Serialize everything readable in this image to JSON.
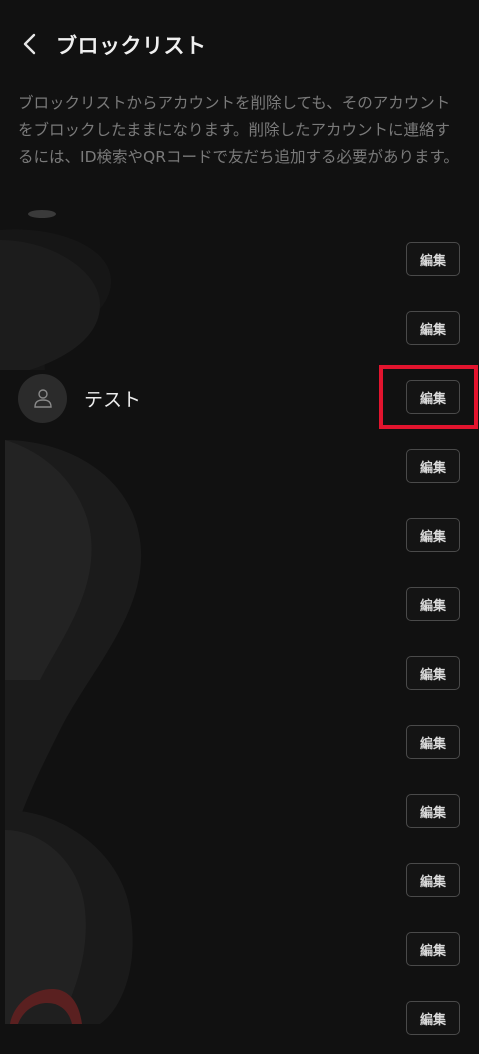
{
  "header": {
    "title": "ブロックリスト",
    "back_icon": "chevron-left-icon"
  },
  "description": "ブロックリストからアカウントを削除しても、そのアカウントをブロックしたままになります。削除したアカウントに連絡するには、ID検索やQRコードで友だち追加する必要があります。",
  "list": {
    "edit_label": "編集",
    "rows": [
      {
        "name": "",
        "hidden": true
      },
      {
        "name": "",
        "hidden": true
      },
      {
        "name": "テスト",
        "hidden": false
      },
      {
        "name": "",
        "hidden": true
      },
      {
        "name": "",
        "hidden": true
      },
      {
        "name": "",
        "hidden": true
      },
      {
        "name": "",
        "hidden": true
      },
      {
        "name": "",
        "hidden": true
      },
      {
        "name": "",
        "hidden": true
      },
      {
        "name": "",
        "hidden": true
      },
      {
        "name": "",
        "hidden": true
      },
      {
        "name": "",
        "hidden": true
      }
    ]
  },
  "colors": {
    "background": "#111111",
    "highlight": "#e3142e"
  }
}
